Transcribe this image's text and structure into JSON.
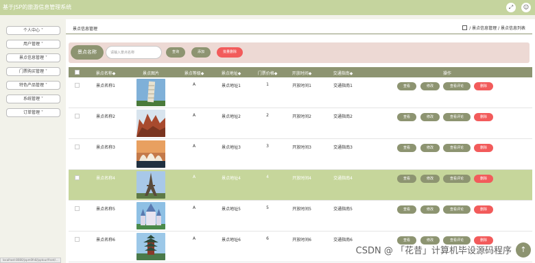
{
  "app": {
    "title": "基于JSP的旅游信息管理系统"
  },
  "topbar_icons": [
    "expand-icon",
    "user-icon"
  ],
  "sidebar": {
    "items": [
      {
        "label": "个人中心 ˅"
      },
      {
        "label": "用户管理 ˅"
      },
      {
        "label": "景点信息管理 ˅"
      },
      {
        "label": "门票购买管理 ˅"
      },
      {
        "label": "特色产品管理 ˅"
      },
      {
        "label": "系统管理 ˅"
      },
      {
        "label": "订单管理 ˅"
      }
    ]
  },
  "page": {
    "title": "景点信息管理",
    "breadcrumb": "/ 景点信息管理 / 景点信息列表"
  },
  "search": {
    "chip_label": "景点名称",
    "placeholder": "请输入景点名称",
    "query_label": "查询",
    "add_label": "添加",
    "bulk_delete_label": "批量删除"
  },
  "table": {
    "headers": {
      "name": "景点名称◆",
      "image": "景点图片",
      "level": "景点等级◆",
      "address": "景点地址◆",
      "price": "门票价格◆",
      "hours": "开放时间◆",
      "guide": "交通指南◆",
      "ops": "操作"
    },
    "actions": {
      "view": "查看",
      "edit": "修改",
      "reviews": "查看评论",
      "delete": "删除"
    },
    "rows": [
      {
        "name": "景点名称1",
        "level": "A",
        "address": "景点地址1",
        "price": "1",
        "hours": "开放时间1",
        "guide": "交通指南1",
        "image": "tower",
        "highlight": false
      },
      {
        "name": "景点名称2",
        "level": "A",
        "address": "景点地址2",
        "price": "2",
        "hours": "开放时间2",
        "guide": "交通指南2",
        "image": "rocks",
        "highlight": false
      },
      {
        "name": "景点名称3",
        "level": "A",
        "address": "景点地址3",
        "price": "3",
        "hours": "开放时间3",
        "guide": "交通指南3",
        "image": "opera",
        "highlight": false
      },
      {
        "name": "景点名称4",
        "level": "A",
        "address": "景点地址4",
        "price": "4",
        "hours": "开放时间4",
        "guide": "交通指南4",
        "image": "eiffel",
        "highlight": true
      },
      {
        "name": "景点名称5",
        "level": "A",
        "address": "景点地址5",
        "price": "5",
        "hours": "开放时间5",
        "guide": "交通指南5",
        "image": "castle",
        "highlight": false
      },
      {
        "name": "景点名称6",
        "level": "A",
        "address": "景点地址6",
        "price": "6",
        "hours": "开放时间6",
        "guide": "交通指南6",
        "image": "pagoda",
        "highlight": false
      }
    ]
  },
  "overlay": {
    "watermark": "CSDN @ 「花昔」计算机毕设源码程序",
    "status_url": "localhost:8080/jspm0fn8/jsptour/front/..."
  },
  "colors": {
    "accent": "#8d9471",
    "delete": "#f25b5b",
    "topbar": "#c5d49e",
    "highlight_row": "#c6d69b",
    "search_bg": "#edd9d4"
  }
}
